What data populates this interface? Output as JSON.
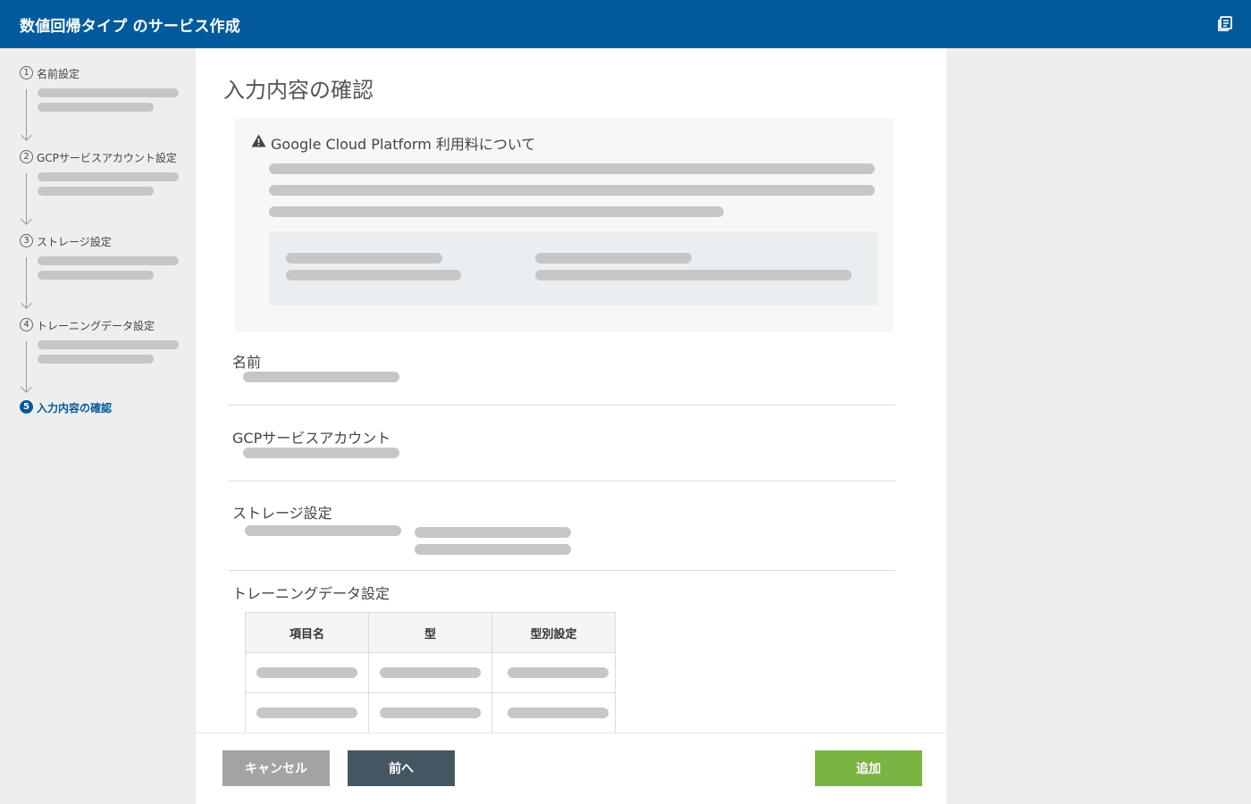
{
  "header": {
    "title": "数値回帰タイプ のサービス作成",
    "doc_icon": "document-stack-icon"
  },
  "sidebar": {
    "steps": [
      {
        "num": "1",
        "label": "名前設定"
      },
      {
        "num": "2",
        "label": "GCPサービスアカウント設定"
      },
      {
        "num": "3",
        "label": "ストレージ設定"
      },
      {
        "num": "4",
        "label": "トレーニングデータ設定"
      },
      {
        "num": "5",
        "label": "入力内容の確認"
      }
    ],
    "active_step": 5
  },
  "main": {
    "title": "入力内容の確認",
    "notice": {
      "icon": "warning-icon",
      "title": "Google Cloud Platform 利用料について"
    },
    "sections": {
      "name": "名前",
      "gcp": "GCPサービスアカウント",
      "storage": "ストレージ設定",
      "training": "トレーニングデータ設定"
    },
    "table": {
      "headers": [
        "項目名",
        "型",
        "型別設定"
      ]
    }
  },
  "footer": {
    "cancel_label": "キャンセル",
    "prev_label": "前へ",
    "add_label": "追加"
  },
  "colors": {
    "header": "#005a9c",
    "add_button": "#7ab443",
    "prev_button": "#455663",
    "cancel_button": "#a3a3a3"
  }
}
